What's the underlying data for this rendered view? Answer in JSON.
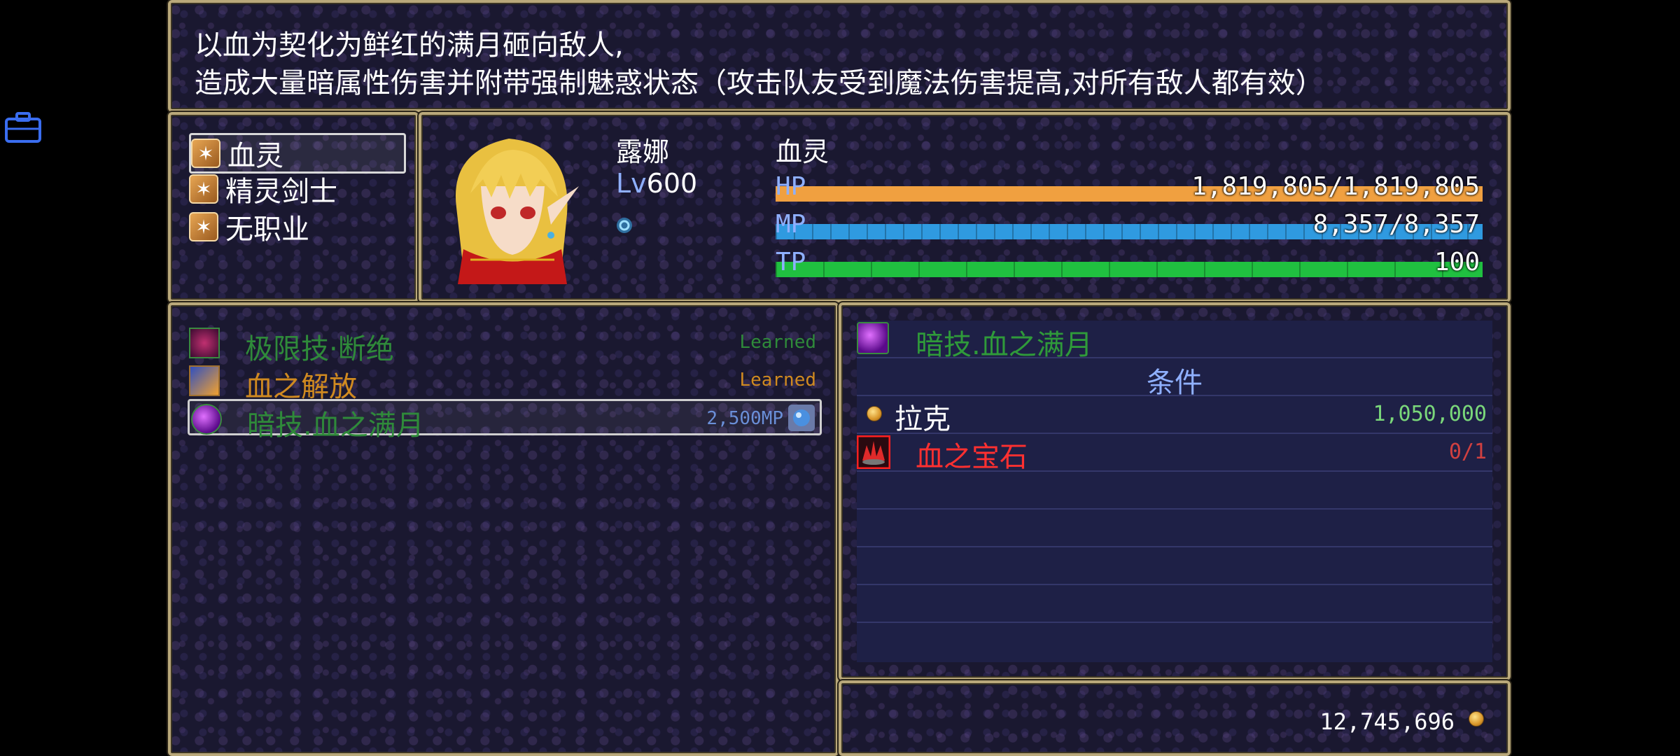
{
  "help": {
    "line1": "以血为契化为鲜红的满月砸向敌人,",
    "line2": "造成大量暗属性伤害并附带强制魅惑状态（攻击队友受到魔法伤害提高,对所有敌人都有效）"
  },
  "overlay": {
    "icon": "briefcase-icon"
  },
  "classes": [
    {
      "label": "血灵",
      "icon": "claw-icon",
      "selected": true
    },
    {
      "label": "精灵剑士",
      "icon": "claw-icon",
      "selected": false
    },
    {
      "label": "无职业",
      "icon": "claw-icon",
      "selected": false
    }
  ],
  "actor": {
    "name": "露娜",
    "level_label": "Lv",
    "level": "600",
    "class_name": "血灵",
    "state_icon": "swirl-state-icon",
    "hp": {
      "label": "HP",
      "text": "1,819,805/1,819,805",
      "ratio": 1.0,
      "color": "#f0a040"
    },
    "mp": {
      "label": "MP",
      "text": "8,357/8,357",
      "ratio": 1.0,
      "color": "#2f9ae0"
    },
    "tp": {
      "label": "TP",
      "text": "100",
      "ratio": 1.0,
      "color": "#20c040"
    }
  },
  "skills": [
    {
      "name": "极限技·断绝",
      "status": "Learned",
      "name_color": "#2f8a3a",
      "status_color": "#2f8a3a",
      "icon": "dark-slash-icon"
    },
    {
      "name": "血之解放",
      "status": "Learned",
      "name_color": "#d08a20",
      "status_color": "#d08a20",
      "icon": "blood-release-icon"
    },
    {
      "name": "暗技.血之满月",
      "status": "2,500MP",
      "name_color": "#2f8a3a",
      "status_color": "#6a8fd8",
      "icon": "dark-orb-icon",
      "selected": true
    }
  ],
  "requirements": {
    "skill_name": "暗技.血之满月",
    "header": "条件",
    "items": [
      {
        "label": "拉克",
        "value": "1,050,000",
        "label_color": "#ffffff",
        "value_color": "#7ad77a",
        "icon": "coin-icon"
      },
      {
        "label": "血之宝石",
        "value": "0/1",
        "label_color": "#ff3030",
        "value_color": "#d04040",
        "icon": "blood-gem-icon"
      }
    ]
  },
  "gold": {
    "amount": "12,745,696",
    "icon": "coin-icon"
  }
}
